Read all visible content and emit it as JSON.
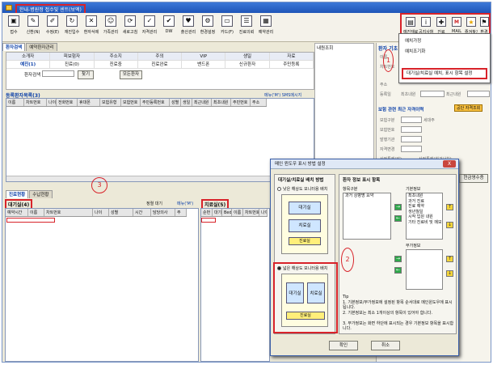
{
  "window": {
    "title": "한내-병원정 접수및 센트(보엑)"
  },
  "toolbar": {
    "items": [
      "접수",
      "신환(N)",
      "수정(E)",
      "재진입수",
      "환자삭제",
      "가족관리",
      "새로고침",
      "자격관리",
      "DW",
      "출산관리",
      "환경설정",
      "카드(F)",
      "진료의뢰",
      "예약관리"
    ],
    "right_labels": [
      "예진재료",
      "공지사항",
      "진료",
      "MAIL",
      "즐겨찾기",
      "환경"
    ]
  },
  "tabs": [
    "환자검색",
    "예약환자관리"
  ],
  "filter": {
    "headers": [
      "소개자",
      "피보험자",
      "주소지",
      "주의",
      "VIP",
      "생일",
      "자료"
    ],
    "row2": [
      "예진(1)",
      "진료(0)",
      "진료중",
      "진료완료",
      "밴드폰",
      "신규환자",
      "주민등록"
    ],
    "search_label": "환자검색",
    "search_btn": "찾기",
    "all_btn": "모든환자"
  },
  "list_title": "등록환자목록(3)",
  "list_right": "메뉴('M')  SMS메시지",
  "list_headers": [
    "이름",
    "차트번호",
    "나이",
    "전화번호",
    "휴대폰",
    "보험유형",
    "보험번호",
    "주민등록번호",
    "성별",
    "생일",
    "최근내원",
    "최초내원",
    "주민번호",
    "주소"
  ],
  "side_label": "내원조회",
  "bottom": {
    "tabs": [
      "진료현황",
      "수납현황"
    ],
    "wait_title": "대기실(4)",
    "treat_title": "치료실(5)",
    "sort_label": "정렬 대기",
    "menu_label": "메뉴('M')",
    "wait_headers": [
      "예약시간",
      "이름",
      "차트번호",
      "나이",
      "성별",
      "시간",
      "담당의사",
      "주"
    ],
    "treat_headers": [
      "순번",
      "대기",
      "Bed",
      "이름",
      "차트번호",
      "나이",
      "성"
    ]
  },
  "right_panel": {
    "title": "환자 기초 정보",
    "fields": [
      "이름",
      "차트번호",
      "주소",
      "등록일",
      "최초내원",
      "최근내원"
    ],
    "insurance_title": "보험 관련 최근 자격이력",
    "ins_fields": [
      "보험구분",
      "보험번호",
      "발행기관",
      "자격변경",
      "세대주"
    ],
    "badge": "공단 자격조회",
    "recent": "산정특례(암)",
    "recent2": "산정특례(희귀난치)",
    "btn": "현금영수증"
  },
  "menu": {
    "items": [
      "예치가정",
      "예치조기화",
      "대기실/치료실 예치, 표시 항목 설정"
    ]
  },
  "dialog": {
    "title": "메인 윈도우 표시 방법 설정",
    "close": "X",
    "left_group": "대기실/치료실 배치 방법",
    "opt1": "낮은 해상도 모니터용 배치",
    "opt2": "넓은 해상도 모니터용 배치",
    "box_wait": "대기실",
    "box_treat": "치료실",
    "strip": "진료실",
    "right_group": "환자 정보 표시 항목",
    "list1_label": "항목구분",
    "list1": [
      "과거 상병명 요약"
    ],
    "list2_label": "기본정보",
    "list2": [
      "최초내원",
      "과거 진료",
      "진료 예약",
      "생년월일",
      "시작 입원 내원",
      "기타 진료비 및 메모"
    ],
    "list3_label": "부가정보",
    "note_label": "Tip",
    "notes": [
      "1. 기본정보/부가정보에 설정된 항목 순서대로 메인윈도우에 표시됩니다.",
      "2. 기본정보는 최소 1개이상의 항목이 있어야 합니다.",
      "3. 부가정보는 화면 하단에 표시되는 경우 기본정보 항목을 표시합니다."
    ],
    "ok": "확인",
    "cancel": "취소"
  },
  "annotations": [
    "1",
    "2",
    "3"
  ]
}
